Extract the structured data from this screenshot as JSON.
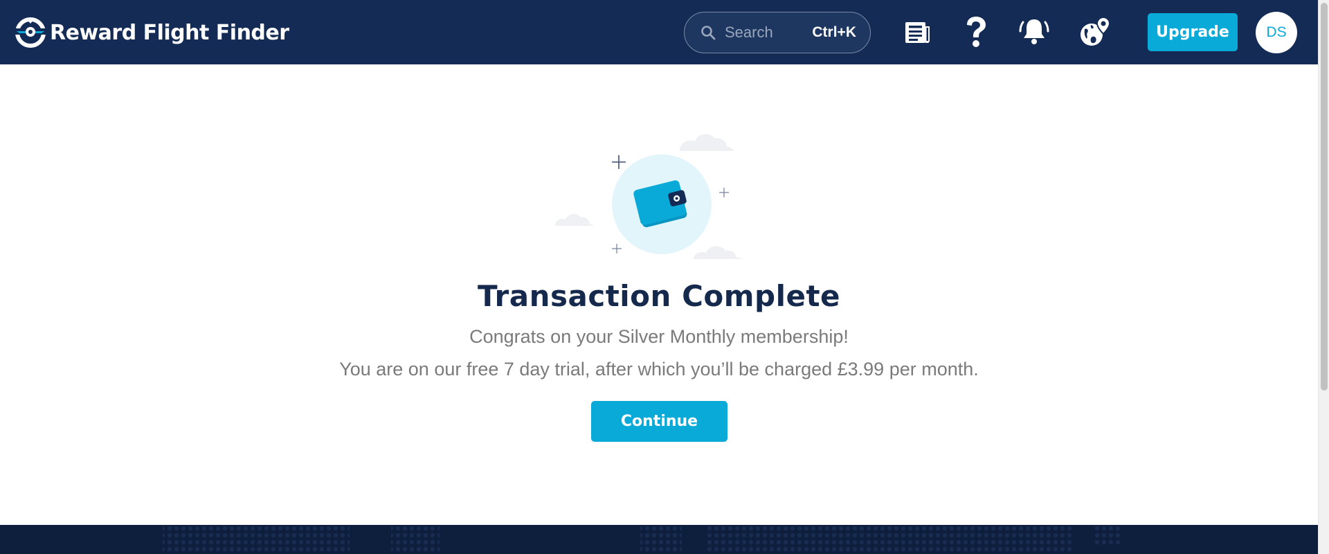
{
  "brand": {
    "name": "Reward Flight Finder"
  },
  "header": {
    "search": {
      "placeholder": "Search",
      "shortcut": "Ctrl+K"
    },
    "icons": [
      "news-icon",
      "help-icon",
      "notification-bell-icon",
      "globe-location-icon"
    ],
    "upgrade_label": "Upgrade",
    "avatar_initials": "DS"
  },
  "main": {
    "title": "Transaction Complete",
    "message_line1": "Congrats on your Silver Monthly membership!",
    "message_line2": "You are on our free 7 day trial, after which you’ll be charged £3.99 per month.",
    "continue_label": "Continue"
  },
  "colors": {
    "nav_bg": "#142c55",
    "accent": "#0aaad8",
    "title": "#15294d",
    "body_text": "#7a7a7a",
    "footer_bg": "#0e1e3d"
  }
}
